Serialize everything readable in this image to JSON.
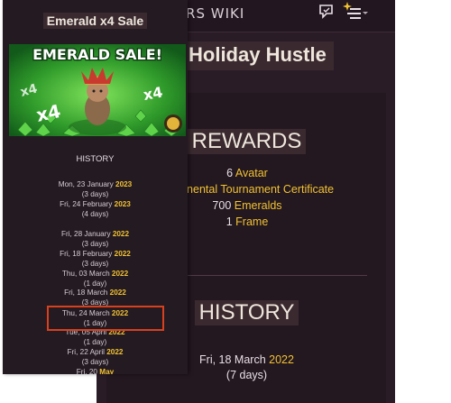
{
  "background_page": {
    "site_title": "HERO WARS WIKI",
    "event_title": "Holiday Hustle",
    "rewards_heading": "REWARDS",
    "rewards": [
      {
        "prefix": "6 ",
        "highlight": "Avatar",
        "suffix": ""
      },
      {
        "prefix": "",
        "highlight": "Continental Tournament Certificate",
        "suffix": ""
      },
      {
        "prefix": "700 ",
        "highlight": "Emeralds",
        "suffix": ""
      },
      {
        "prefix": "1 ",
        "highlight": "Frame",
        "suffix": ""
      }
    ],
    "history_heading": "HISTORY",
    "history_date_prefix": "Fri, 18 March ",
    "history_date_year": "2022",
    "history_duration": "(7 days)",
    "icons": [
      "chat-icon",
      "menu-icon"
    ]
  },
  "front_panel": {
    "title": "Emerald x4 Sale",
    "banner": {
      "headline": "EMERALD SALE!",
      "multiplier": "x4"
    },
    "history_label": "HISTORY",
    "history": [
      {
        "date": "Mon, 23 January ",
        "year": "2023",
        "duration": "(3 days)"
      },
      {
        "date": "Fri, 24 February ",
        "year": "2023",
        "duration": "(4 days)"
      },
      {
        "date": "Fri, 28 January ",
        "year": "2022",
        "duration": "(3 days)"
      },
      {
        "date": "Fri, 18 February ",
        "year": "2022",
        "duration": "(3 days)"
      },
      {
        "date": "Thu, 03 March ",
        "year": "2022",
        "duration": "(1 day)"
      },
      {
        "date": "Fri, 18 March ",
        "year": "2022",
        "duration": "(3 days)"
      },
      {
        "date": "Thu, 24 March ",
        "year": "2022",
        "duration": "(1 day)"
      },
      {
        "date": "Tue, 05 April ",
        "year": "2022",
        "duration": "(1 day)"
      },
      {
        "date": "Fri, 22 April ",
        "year": "2022",
        "duration": "(3 days)"
      },
      {
        "date": "Fri, 20 ",
        "year": "May",
        "duration": ""
      }
    ],
    "highlighted_entry": "Thu, 24 March 2022"
  },
  "colors": {
    "accent_gold": "#f1c232",
    "highlight_box": "#d8401e",
    "page_bg": "#2a1c26"
  }
}
